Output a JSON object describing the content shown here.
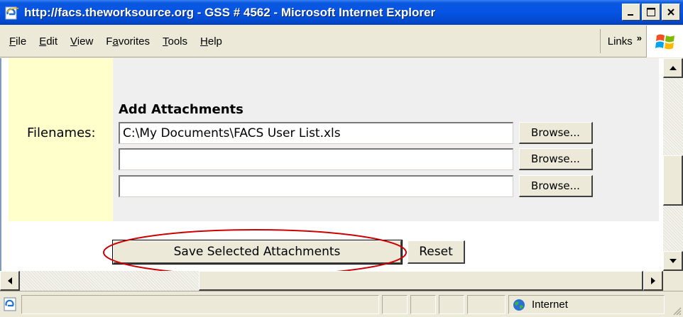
{
  "window": {
    "title": "http://facs.theworksource.org - GSS # 4562 - Microsoft Internet Explorer",
    "controls": {
      "minimize": "_",
      "maximize": "□",
      "close": "x"
    }
  },
  "menubar": {
    "items": [
      {
        "label": "File",
        "accel": "F"
      },
      {
        "label": "Edit",
        "accel": "E"
      },
      {
        "label": "View",
        "accel": "V"
      },
      {
        "label": "Favorites",
        "accel": "a"
      },
      {
        "label": "Tools",
        "accel": "T"
      },
      {
        "label": "Help",
        "accel": "H"
      }
    ],
    "links_label": "Links",
    "links_chevron": "»"
  },
  "form": {
    "heading": "Add Attachments",
    "filenames_label": "Filenames:",
    "files": [
      {
        "value": "C:\\My Documents\\FACS User List.xls",
        "browse_label": "Browse..."
      },
      {
        "value": "",
        "browse_label": "Browse..."
      },
      {
        "value": "",
        "browse_label": "Browse..."
      }
    ],
    "save_label": "Save Selected Attachments",
    "reset_label": "Reset",
    "highlight_color": "#cc0000"
  },
  "statusbar": {
    "text": "",
    "zone_label": "Internet"
  },
  "colors": {
    "titlebar": "#0554e3",
    "chrome": "#ece9d8",
    "label_column": "#ffffcc",
    "form_panel": "#efefef"
  }
}
